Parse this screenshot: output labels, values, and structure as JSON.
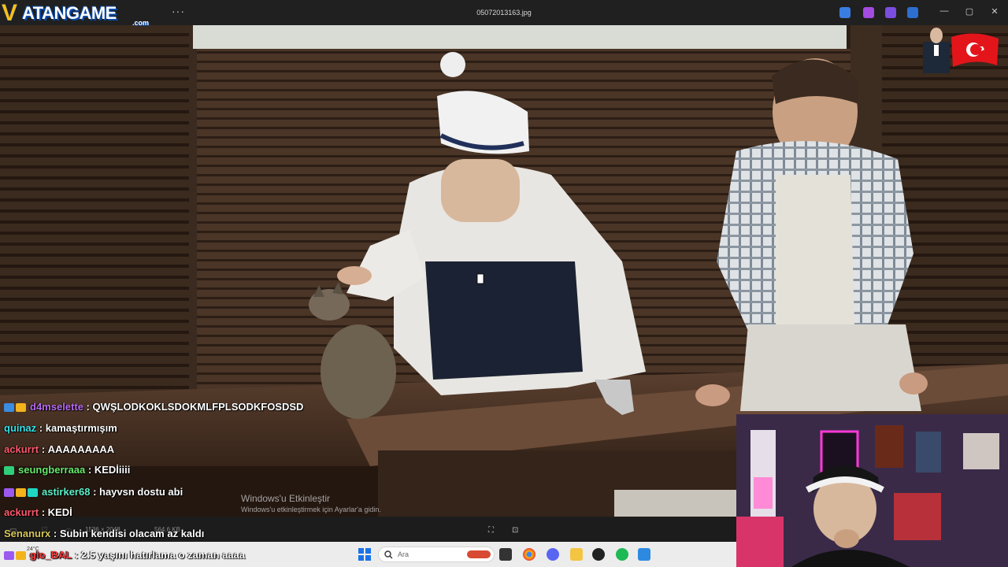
{
  "window": {
    "title": "05072013163.jpg",
    "more_label": "···",
    "minimize": "—",
    "maximize": "▢",
    "close": "✕"
  },
  "logo": {
    "v": "V",
    "word": "ATANGAME",
    "domain": ".com"
  },
  "viewer_toolbar": {
    "dimensions": "1536 × 2048",
    "file_size": "564.6 KB"
  },
  "activation": {
    "heading": "Windows'u Etkinleştir",
    "subtext": "Windows'u etkinleştirmek için Ayarlar'a gidin."
  },
  "taskbar": {
    "search_placeholder": "Ara",
    "weather": "24°C"
  },
  "chat": {
    "messages": [
      {
        "user": "d4mselette",
        "text": "QWŞLODKOKLSDOKMLFPLSODKFOSDSD",
        "color": "#b96bf0",
        "badges": [
          "#3a8de0",
          "#f2b31c"
        ]
      },
      {
        "user": "quinaz",
        "text": "kamaştırmışım",
        "color": "#38e2e8",
        "badges": []
      },
      {
        "user": "ackurrt",
        "text": "AAAAAAAAA",
        "color": "#ff5a6e",
        "badges": []
      },
      {
        "user": "seungberraaa",
        "text": "KEDİiiii",
        "color": "#67e86a",
        "badges": [
          "#2fcf7a"
        ]
      },
      {
        "user": "astirker68",
        "text": "hayvsn dostu abi",
        "color": "#5cf0c8",
        "badges": [
          "#9b59f0",
          "#f2b31c",
          "#1fd6c2"
        ]
      },
      {
        "user": "ackurrt",
        "text": "KEDİ",
        "color": "#ff5a6e",
        "badges": []
      },
      {
        "user": "Senanurx",
        "text": "Subin kendisi olacam az kaldı",
        "color": "#d9c85a",
        "badges": []
      },
      {
        "user": "glo_BAL",
        "text": "2.5 yaşını hatırlama o zaman aaaa",
        "color": "#ff3b3b",
        "badges": [
          "#9b59f0",
          "#f2b31c"
        ]
      }
    ]
  }
}
